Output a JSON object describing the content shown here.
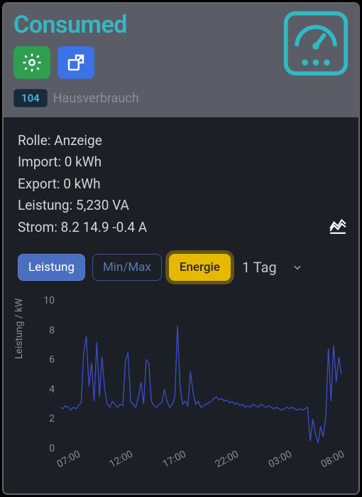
{
  "header": {
    "title": "Consumed",
    "badge_value": "104",
    "badge_label": "Hausverbrauch"
  },
  "stats": {
    "rolle_label": "Rolle",
    "rolle_value": "Anzeige",
    "import_label": "Import",
    "import_value": "0 kWh",
    "export_label": "Export",
    "export_value": "0 kWh",
    "leistung_label": "Leistung",
    "leistung_value": "5,230 VA",
    "strom_label": "Strom",
    "strom_value": "8.2 14.9 -0.4 A"
  },
  "controls": {
    "tab_leistung": "Leistung",
    "tab_minmax": "Min/Max",
    "tab_energie": "Energie",
    "period_label": "1 Tag",
    "period_options": [
      "1 Tag"
    ]
  },
  "chart_data": {
    "type": "line",
    "ylabel": "Leistung / kW",
    "ylim": [
      0,
      10
    ],
    "yticks": [
      0,
      2,
      4,
      6,
      8,
      10
    ],
    "xticks": [
      "07:00",
      "12:00",
      "17:00",
      "22:00",
      "03:00",
      "08:00"
    ],
    "x": [
      "07:00",
      "07:15",
      "07:30",
      "07:45",
      "08:00",
      "08:15",
      "08:30",
      "08:45",
      "09:00",
      "09:15",
      "09:30",
      "09:45",
      "10:00",
      "10:15",
      "10:30",
      "10:45",
      "11:00",
      "11:15",
      "11:30",
      "11:45",
      "12:00",
      "12:15",
      "12:30",
      "12:45",
      "13:00",
      "13:15",
      "13:30",
      "13:45",
      "14:00",
      "14:15",
      "14:30",
      "14:45",
      "15:00",
      "15:15",
      "15:30",
      "15:45",
      "16:00",
      "16:15",
      "16:30",
      "16:45",
      "17:00",
      "17:15",
      "17:30",
      "17:45",
      "18:00",
      "18:15",
      "18:30",
      "18:45",
      "19:00",
      "19:15",
      "19:30",
      "19:45",
      "20:00",
      "20:15",
      "20:30",
      "20:45",
      "21:00",
      "21:15",
      "21:30",
      "21:45",
      "22:00",
      "22:15",
      "22:30",
      "22:45",
      "23:00",
      "23:15",
      "23:30",
      "23:45",
      "00:00",
      "00:15",
      "00:30",
      "00:45",
      "01:00",
      "01:15",
      "01:30",
      "01:45",
      "02:00",
      "02:15",
      "02:30",
      "02:45",
      "03:00",
      "03:15",
      "03:30",
      "03:45",
      "04:00",
      "04:15",
      "04:30",
      "04:45",
      "05:00",
      "05:15",
      "05:30",
      "05:45",
      "06:00",
      "06:15",
      "06:30",
      "06:45",
      "07:00",
      "07:15",
      "07:30",
      "07:45",
      "08:00",
      "08:15",
      "08:30",
      "08:45",
      "09:00",
      "09:15",
      "09:30",
      "09:45",
      "10:00"
    ],
    "series": [
      {
        "name": "Leistung",
        "values": [
          2.8,
          2.7,
          2.9,
          2.8,
          2.6,
          2.8,
          2.7,
          2.9,
          3.1,
          6.5,
          7.6,
          4.2,
          5.8,
          3.2,
          7.2,
          3.5,
          6.2,
          4.1,
          3.0,
          2.8,
          3.2,
          3.0,
          2.8,
          3.0,
          2.9,
          5.9,
          6.5,
          3.2,
          3.0,
          2.8,
          3.5,
          4.5,
          3.0,
          6.0,
          5.8,
          3.2,
          2.9,
          2.8,
          3.0,
          3.1,
          4.0,
          3.2,
          2.8,
          3.0,
          3.5,
          8.3,
          4.2,
          3.0,
          3.2,
          2.9,
          5.2,
          3.8,
          3.0,
          3.2,
          2.8,
          2.9,
          3.0,
          3.1,
          3.2,
          3.4,
          3.5,
          3.3,
          3.4,
          3.2,
          3.3,
          3.1,
          3.2,
          3.0,
          3.1,
          2.9,
          3.0,
          2.8,
          2.9,
          2.8,
          3.0,
          2.9,
          2.8,
          3.0,
          2.9,
          2.8,
          2.9,
          2.8,
          2.7,
          2.8,
          2.7,
          2.6,
          2.7,
          2.8,
          2.7,
          2.8,
          2.7,
          2.6,
          2.7,
          2.6,
          2.7,
          2.8,
          0.5,
          2.0,
          1.0,
          0.4,
          1.5,
          0.8,
          2.2,
          6.8,
          3.2,
          7.0,
          4.5,
          6.2,
          5.0
        ]
      }
    ]
  }
}
